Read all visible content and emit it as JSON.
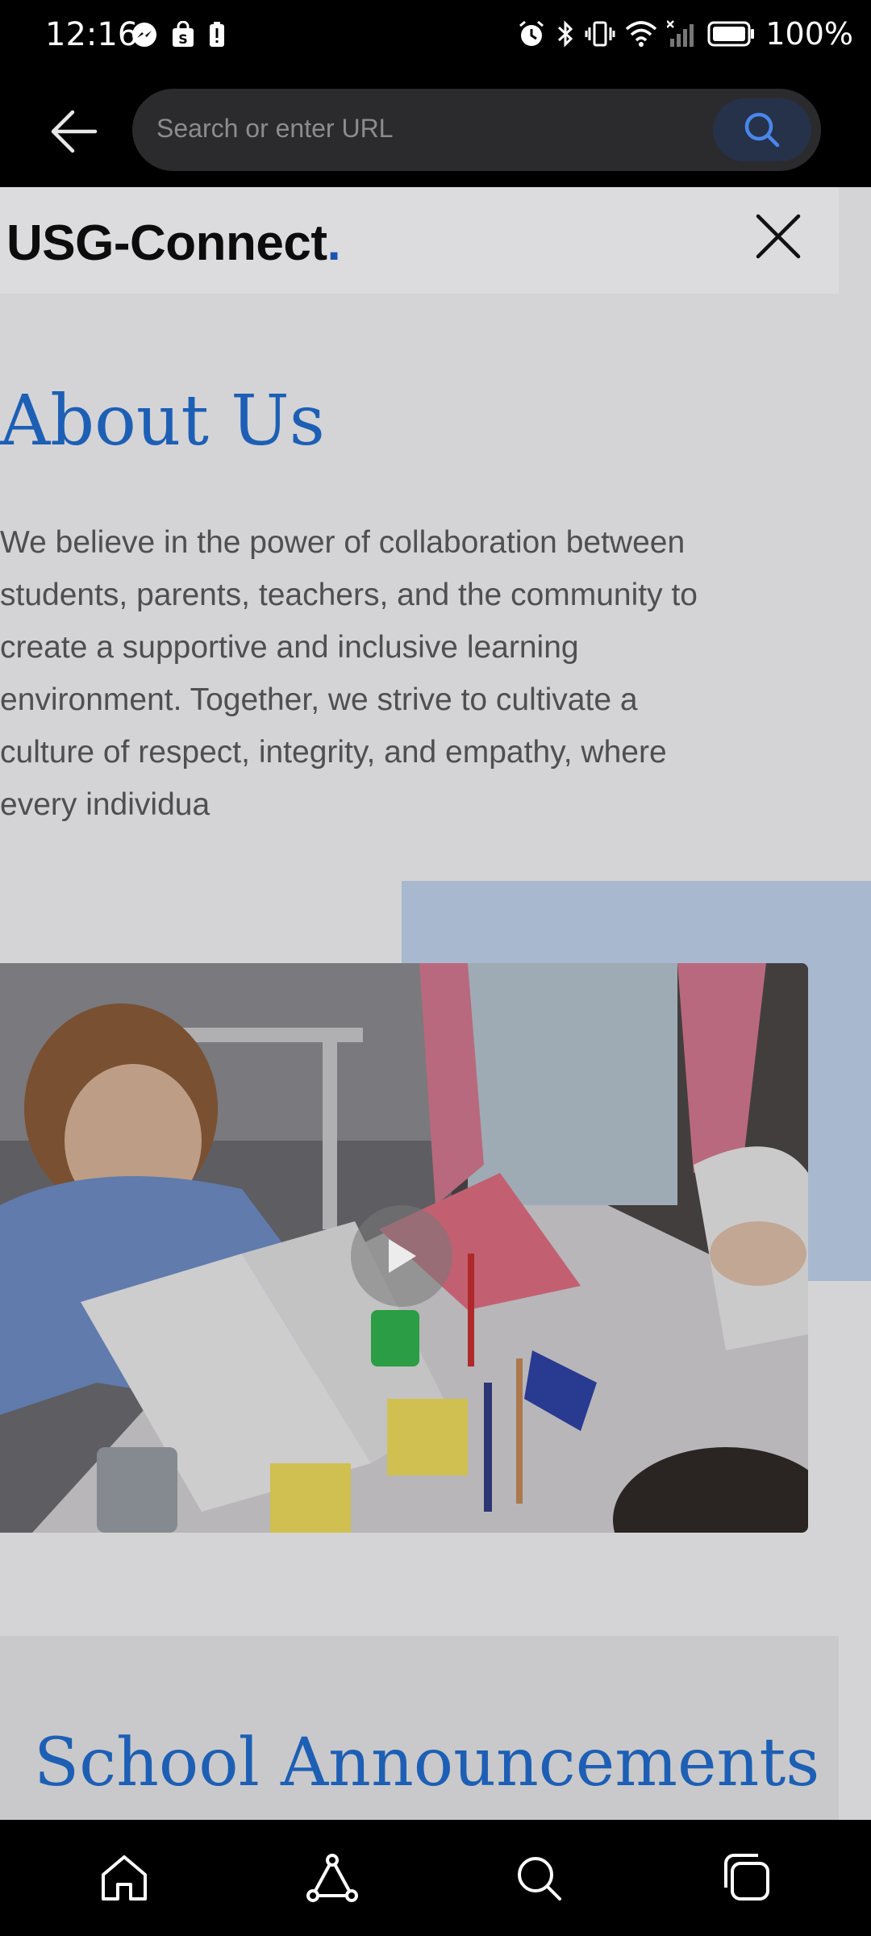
{
  "status_bar": {
    "time": "12:16",
    "battery": "100%",
    "left_icons": [
      "messenger-icon",
      "shopping-bag-icon",
      "battery-alert-icon"
    ],
    "right_icons": [
      "alarm-icon",
      "bluetooth-icon",
      "vibrate-icon",
      "wifi-icon",
      "signal-icon",
      "battery-icon"
    ]
  },
  "browser": {
    "url_placeholder": "Search or enter URL",
    "accent_color": "#4a86ea"
  },
  "site": {
    "brand_name": "USG-Connect",
    "brand_dot": ".",
    "brand_dot_color": "#1c54b0"
  },
  "about": {
    "title": "About Us",
    "body": "We believe in the power of collaboration between\nstudents, parents, teachers, and the community to\ncreate a supportive and inclusive learning\nenvironment. Together, we strive to cultivate a\nculture of respect, integrity, and empathy, where\nevery individua",
    "title_color": "#1d5fb5"
  },
  "media": {
    "play_icon": "play-icon"
  },
  "announcements": {
    "title": "School Announcements"
  },
  "nav": {
    "items": [
      "home-icon",
      "share-icon",
      "search-icon",
      "tabs-icon"
    ]
  }
}
